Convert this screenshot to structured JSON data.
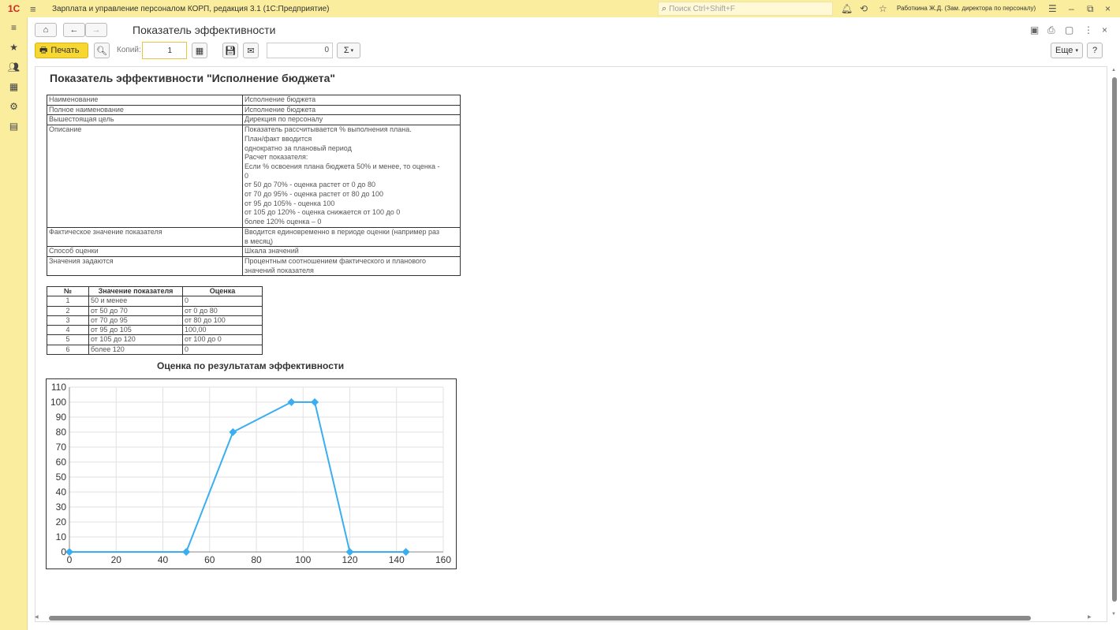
{
  "app": {
    "logo": "1С",
    "title": "Зарплата и управление персоналом КОРП, редакция 3.1  (1С:Предприятие)",
    "search_placeholder": "Поиск Ctrl+Shift+F",
    "user": "Работкина Ж.Д. (Зам. директора по персоналу)"
  },
  "sidebar": {
    "icons": [
      "menu-icon",
      "star-icon",
      "people-icon",
      "calculator-icon",
      "gear-icon",
      "id-card-icon"
    ]
  },
  "form": {
    "title": "Показатель эффективности",
    "print_label": "Печать",
    "copies_label": "Копий:",
    "copies_value": "1",
    "sum_value": "0",
    "sigma": "Σ",
    "more_label": "Еще",
    "help_label": "?"
  },
  "report": {
    "title": "Показатель эффективности \"Исполнение бюджета\"",
    "properties": [
      {
        "key": "Наименование",
        "value": "Исполнение бюджета"
      },
      {
        "key": "Полное наименование",
        "value": "Исполнение бюджета"
      },
      {
        "key": "Вышестоящая цель",
        "value": "Дирекция по персоналу"
      },
      {
        "key": "Описание",
        "value": "Показатель рассчитывается % выполнения плана.\nПлан/факт вводится\nоднократно за плановый период\nРасчет показателя:\nЕсли % освоения плана бюджета 50% и менее, то оценка -\n0\nот 50 до 70% - оценка растет от 0 до 80\nот 70 до 95% - оценка растет от 80 до 100\nот 95 до 105% - оценка 100\nот 105 до 120% - оценка снижается от 100 до 0\nболее 120% оценка – 0"
      },
      {
        "key": "Фактическое значение показателя",
        "value": "Вводится единовременно в периоде оценки (например раз\nв месяц)"
      },
      {
        "key": "Способ оценки",
        "value": "Шкала значений"
      },
      {
        "key": "Значения задаются",
        "value": "Процентным соотношением фактического и планового\nзначений показателя"
      }
    ],
    "scale_headers": [
      "№",
      "Значение показателя",
      "Оценка"
    ],
    "scale_rows": [
      [
        "1",
        "50 и менее",
        "0"
      ],
      [
        "2",
        "от 50 до 70",
        "от 0 до 80"
      ],
      [
        "3",
        "от 70 до 95",
        "от 80 до 100"
      ],
      [
        "4",
        "от 95 до 105",
        "100,00"
      ],
      [
        "5",
        "от 105 до 120",
        "от 100 до 0"
      ],
      [
        "6",
        "более 120",
        "0"
      ]
    ],
    "chart_title": "Оценка по результатам эффективности"
  },
  "chart_data": {
    "type": "line",
    "title": "Оценка по результатам эффективности",
    "x": [
      0,
      50,
      70,
      95,
      105,
      120,
      144
    ],
    "y": [
      0,
      0,
      80,
      100,
      100,
      0,
      0
    ],
    "xlim": [
      0,
      160
    ],
    "ylim": [
      0,
      110
    ],
    "x_ticks": [
      0,
      20,
      40,
      60,
      80,
      100,
      120,
      140,
      160
    ],
    "y_ticks": [
      0,
      10,
      20,
      30,
      40,
      50,
      60,
      70,
      80,
      90,
      100,
      110
    ],
    "grid": true,
    "legend": "none",
    "color": "#3aaef0"
  }
}
